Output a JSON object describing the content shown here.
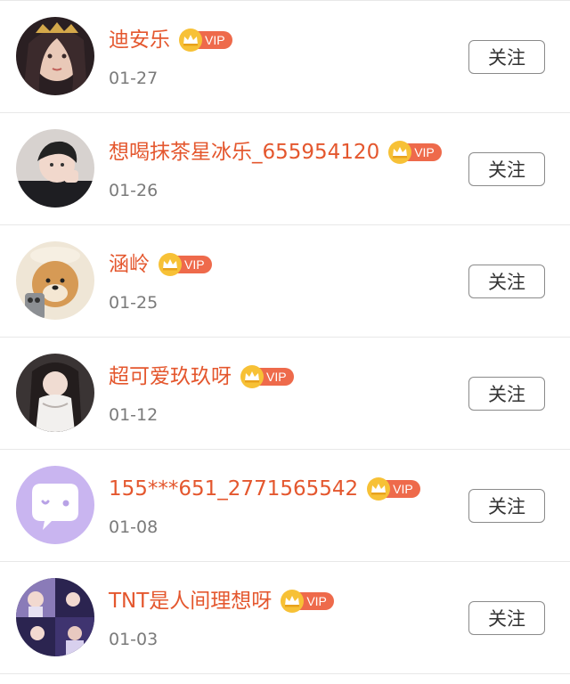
{
  "follow_list": {
    "items": [
      {
        "name": "迪安乐",
        "date": "01-27",
        "badge": "VIP",
        "button_label": "关注"
      },
      {
        "name": "想喝抹茶星冰乐_655954120",
        "date": "01-26",
        "badge": "VIP",
        "button_label": "关注"
      },
      {
        "name": "涵岭",
        "date": "01-25",
        "badge": "VIP",
        "button_label": "关注"
      },
      {
        "name": "超可爱玖玖呀",
        "date": "01-12",
        "badge": "VIP",
        "button_label": "关注"
      },
      {
        "name": "155***651_2771565542",
        "date": "01-08",
        "badge": "VIP",
        "button_label": "关注"
      },
      {
        "name": "TNT是人间理想呀",
        "date": "01-03",
        "badge": "VIP",
        "button_label": "关注"
      }
    ]
  },
  "colors": {
    "name_text": "#e4572e",
    "vip_tag": "#ee6a4b",
    "crown": "#f7c136",
    "date_text": "#7a7a7a",
    "button_border": "#8a8a8a",
    "default_avatar_bg": "#c9b5f0"
  },
  "icons": {
    "vip": "crown-icon",
    "default_avatar": "chat-bubble-icon"
  }
}
